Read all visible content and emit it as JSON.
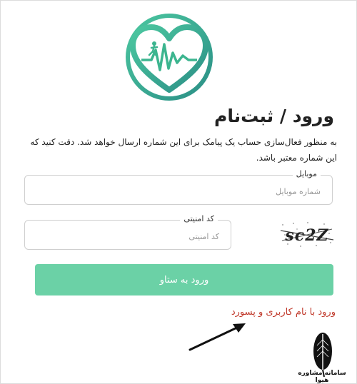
{
  "header": {
    "title": "ورود / ثبت‌نام",
    "description": "به منظور فعال‌سازی حساب یک پیامک برای این شماره ارسال خواهد شد. دقت کنید که این شماره معتبر باشد."
  },
  "mobile_field": {
    "label": "موبایل",
    "placeholder": "شماره موبایل"
  },
  "security_field": {
    "label": "کد امنیتی",
    "placeholder": "کد امنیتی"
  },
  "captcha": {
    "text": "sc2Z"
  },
  "login_button": {
    "label": "ورود به ستاو"
  },
  "username_link": {
    "label": "ورود با نام کاربری و پسورد"
  },
  "watermark": {
    "text": "سامانه مشاوره هیوا"
  },
  "colors": {
    "accent": "#6bd1a6",
    "logo": "#3cb58f",
    "link": "#c0392b"
  }
}
